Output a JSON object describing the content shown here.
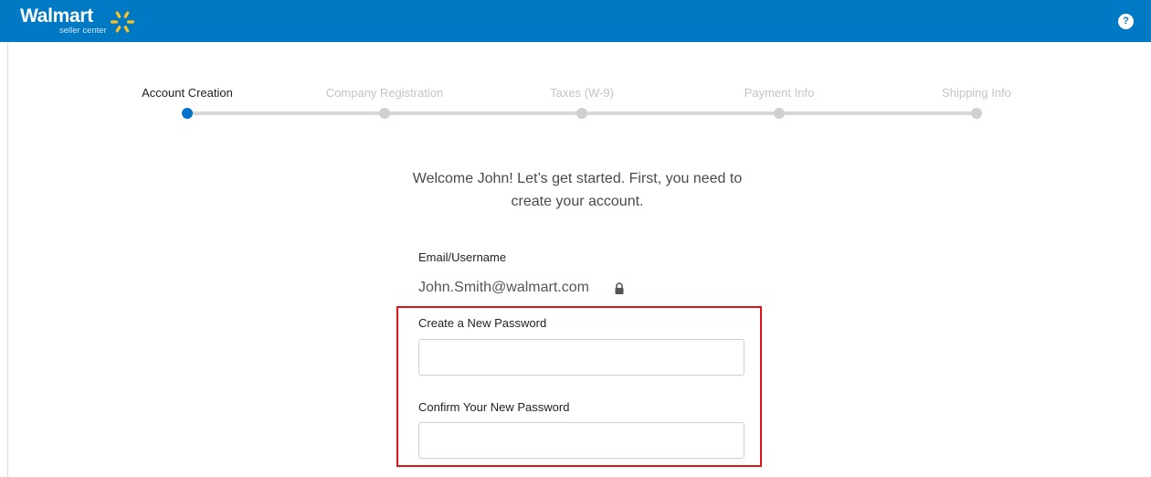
{
  "header": {
    "brand": "Walmart",
    "brand_sub": "seller center",
    "help_label": "?",
    "colors": {
      "bar": "#0079c4",
      "spark": "#ffc220"
    }
  },
  "steps": [
    {
      "label": "Account Creation",
      "state": "active"
    },
    {
      "label": "Company Registration",
      "state": "inactive"
    },
    {
      "label": "Taxes (W-9)",
      "state": "inactive"
    },
    {
      "label": "Payment Info",
      "state": "inactive"
    },
    {
      "label": "Shipping Info",
      "state": "inactive"
    }
  ],
  "welcome": {
    "line1": "Welcome John! Let’s get started. First, you need to",
    "line2": "create your account."
  },
  "form": {
    "email_label": "Email/Username",
    "email_value": "John.Smith@walmart.com",
    "email_icon": "lock-icon",
    "new_password_label": "Create a New Password",
    "new_password_value": "",
    "confirm_password_label": "Confirm Your New Password",
    "confirm_password_value": "",
    "highlight_color": "#e0141b"
  }
}
